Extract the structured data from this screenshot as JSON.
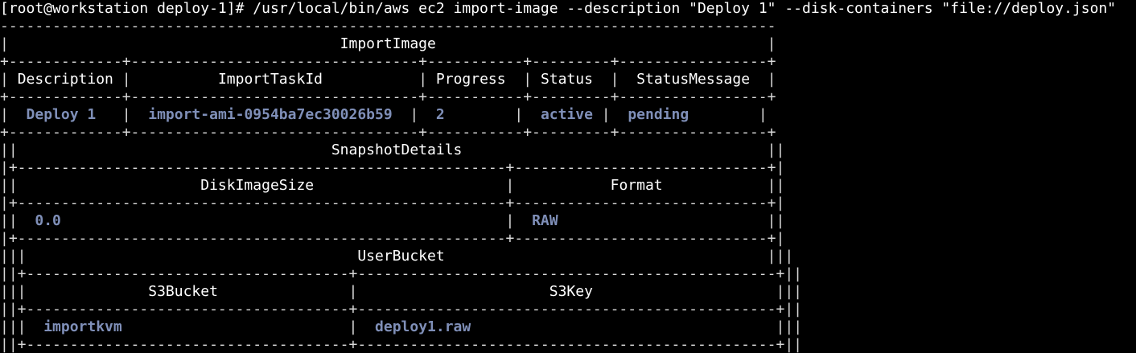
{
  "terminal": {
    "prompt": "[root@workstation deploy-1]# ",
    "command": "/usr/local/bin/aws ec2 import-image --description \"Deploy 1\" --disk-containers \"file://deploy.json\""
  },
  "import_image": {
    "title": "ImportImage",
    "headers": [
      "Description",
      "ImportTaskId",
      "Progress",
      "Status",
      "StatusMessage"
    ],
    "row": {
      "description": "Deploy 1",
      "import_task_id": "import-ami-0954ba7ec30026b59",
      "progress": "2",
      "status": "active",
      "status_message": "pending"
    }
  },
  "snapshot_details": {
    "title": "SnapshotDetails",
    "headers": [
      "DiskImageSize",
      "Format"
    ],
    "row": {
      "disk_image_size": "0.0",
      "format": "RAW"
    }
  },
  "user_bucket": {
    "title": "UserBucket",
    "headers": [
      "S3Bucket",
      "S3Key"
    ],
    "row": {
      "s3_bucket": "importkvm",
      "s3_key": "deploy1.raw"
    }
  },
  "colors": {
    "background": "#000000",
    "text": "#ffffff",
    "value": "#7f8fb8"
  }
}
